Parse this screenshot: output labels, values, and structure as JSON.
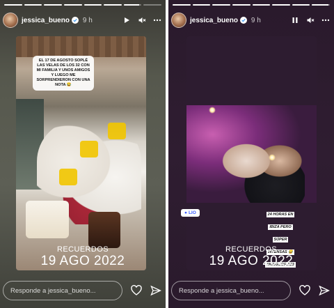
{
  "stories": [
    {
      "progress": 0.85,
      "username": "jessica_bueno",
      "time": "9 h",
      "note_text": "EL 17 DE AGOSTO SOPLÉ LAS VELAS DE LOS 32 CON MI FAMILIA Y UNOS AMIGOS Y LUEGO ME SORPRENDIERON CON UNA NOTA 😂",
      "recuerdos_label": "RECUERDOS",
      "recuerdos_date": "19 AGO 2022",
      "reply_placeholder": "Responde a jessica_bueno...",
      "play_state": "play"
    },
    {
      "progress": 0.92,
      "username": "jessica_bueno",
      "time": "9 h",
      "location": "LIO",
      "sticker_lines": [
        "24 HORAS EN",
        "IBIZA PERO",
        "SÚPER",
        "INTENSAS 😂",
        "#KINGSOFIA23"
      ],
      "recuerdos_label": "RECUERDOS",
      "recuerdos_date": "19 AGO 2022",
      "reply_placeholder": "Responde a jessica_bueno...",
      "play_state": "pause"
    }
  ],
  "colors": {
    "accent_blue": "#3b5bff",
    "verified_blue": "#3897f0"
  }
}
